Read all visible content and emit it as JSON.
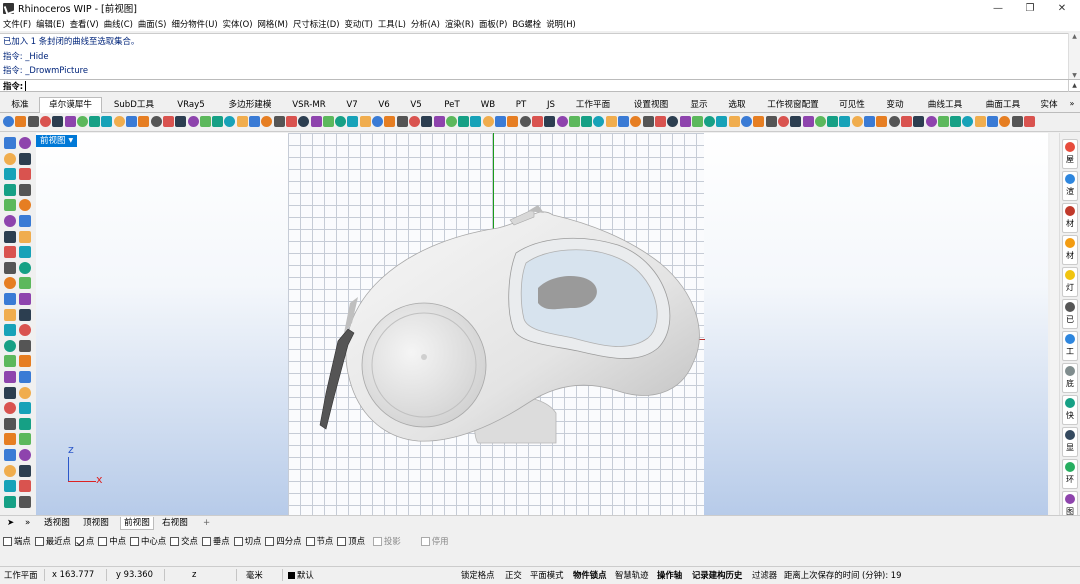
{
  "window": {
    "title": "Rhinoceros WIP - [前视图]",
    "minimize": "—",
    "maximize": "❐",
    "close": "✕"
  },
  "menu": [
    "文件(F)",
    "编辑(E)",
    "查看(V)",
    "曲线(C)",
    "曲面(S)",
    "细分物件(U)",
    "实体(O)",
    "网格(M)",
    "尺寸标注(D)",
    "变动(T)",
    "工具(L)",
    "分析(A)",
    "渲染(R)",
    "面板(P)",
    "BG螺栓",
    "说明(H)"
  ],
  "history": [
    "已加入 1 条封闭的曲线至选取集合。",
    "指令: _Hide",
    "指令: _DrowmPicture"
  ],
  "command": {
    "prompt": "指令:"
  },
  "tabs": [
    "标准",
    "卓尔谟犀牛",
    "SubD工具",
    "VRay5",
    "多边形建模",
    "VSR-MR",
    "V7",
    "V6",
    "V5",
    "PeT",
    "WB",
    "PT",
    "JS",
    "工作平面",
    "设置视图",
    "显示",
    "选取",
    "工作视窗配置",
    "可见性",
    "变动",
    "曲线工具",
    "曲面工具",
    "实体"
  ],
  "active_tab": "卓尔谟犀牛",
  "viewport": {
    "label": "前视图",
    "axis_z": "z",
    "axis_x": "x"
  },
  "right_panels": [
    "屋",
    "渲",
    "材",
    "材",
    "灯",
    "已",
    "工",
    "底",
    "快",
    "显",
    "环",
    "图"
  ],
  "view_tabs": [
    "透视图",
    "顶视图",
    "前视图",
    "右视图"
  ],
  "active_view_tab": "前视图",
  "view_tab_add": "+",
  "osnaps": [
    {
      "label": "端点",
      "checked": false,
      "enabled": true
    },
    {
      "label": "最近点",
      "checked": false,
      "enabled": true
    },
    {
      "label": "点",
      "checked": true,
      "enabled": true
    },
    {
      "label": "中点",
      "checked": false,
      "enabled": true
    },
    {
      "label": "中心点",
      "checked": false,
      "enabled": true
    },
    {
      "label": "交点",
      "checked": false,
      "enabled": true
    },
    {
      "label": "垂点",
      "checked": false,
      "enabled": true
    },
    {
      "label": "切点",
      "checked": false,
      "enabled": true
    },
    {
      "label": "四分点",
      "checked": false,
      "enabled": true
    },
    {
      "label": "节点",
      "checked": false,
      "enabled": true
    },
    {
      "label": "顶点",
      "checked": false,
      "enabled": true
    },
    {
      "label": "投影",
      "checked": false,
      "enabled": false
    },
    {
      "label": "停用",
      "checked": false,
      "enabled": false
    }
  ],
  "status": {
    "cplane": "工作平面",
    "x": "x 163.777",
    "y": "y 93.360",
    "z": "z",
    "units": "毫米",
    "layer": "默认",
    "grid_snap": "锁定格点",
    "ortho": "正交",
    "planar": "平面模式",
    "osnap": "物件锁点",
    "smarttrack": "智慧轨迹",
    "gumball": "操作轴",
    "history": "记录建构历史",
    "filter": "过滤器",
    "autosave": "距离上次保存的时间 (分钟): 19"
  },
  "colors": {
    "viewport_label_bg": "#0079d7",
    "axis_y": "#1a9a1a",
    "axis_x": "#b83030",
    "gizmo_z": "#2b57c9",
    "gizmo_x": "#dd2222"
  }
}
